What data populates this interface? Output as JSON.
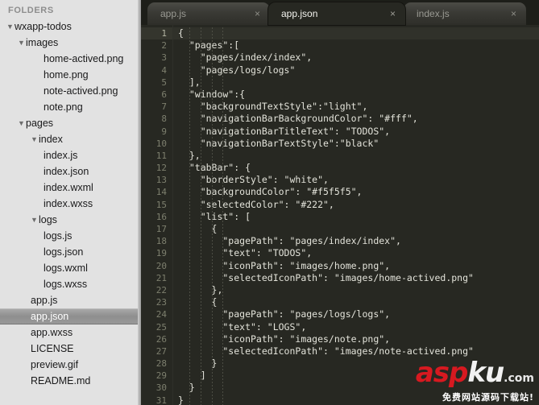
{
  "sidebar": {
    "header": "FOLDERS",
    "tree": [
      {
        "label": "wxapp-todos",
        "depth": 0,
        "type": "folder",
        "expanded": true,
        "selected": false
      },
      {
        "label": "images",
        "depth": 1,
        "type": "folder",
        "expanded": true,
        "selected": false
      },
      {
        "label": "home-actived.png",
        "depth": 3,
        "type": "file",
        "selected": false
      },
      {
        "label": "home.png",
        "depth": 3,
        "type": "file",
        "selected": false
      },
      {
        "label": "note-actived.png",
        "depth": 3,
        "type": "file",
        "selected": false
      },
      {
        "label": "note.png",
        "depth": 3,
        "type": "file",
        "selected": false
      },
      {
        "label": "pages",
        "depth": 1,
        "type": "folder",
        "expanded": true,
        "selected": false
      },
      {
        "label": "index",
        "depth": 2,
        "type": "folder",
        "expanded": true,
        "selected": false
      },
      {
        "label": "index.js",
        "depth": 3,
        "type": "file",
        "selected": false
      },
      {
        "label": "index.json",
        "depth": 3,
        "type": "file",
        "selected": false
      },
      {
        "label": "index.wxml",
        "depth": 3,
        "type": "file",
        "selected": false
      },
      {
        "label": "index.wxss",
        "depth": 3,
        "type": "file",
        "selected": false
      },
      {
        "label": "logs",
        "depth": 2,
        "type": "folder",
        "expanded": true,
        "selected": false
      },
      {
        "label": "logs.js",
        "depth": 3,
        "type": "file",
        "selected": false
      },
      {
        "label": "logs.json",
        "depth": 3,
        "type": "file",
        "selected": false
      },
      {
        "label": "logs.wxml",
        "depth": 3,
        "type": "file",
        "selected": false
      },
      {
        "label": "logs.wxss",
        "depth": 3,
        "type": "file",
        "selected": false
      },
      {
        "label": "app.js",
        "depth": 2,
        "type": "file",
        "selected": false
      },
      {
        "label": "app.json",
        "depth": 2,
        "type": "file",
        "selected": true
      },
      {
        "label": "app.wxss",
        "depth": 2,
        "type": "file",
        "selected": false
      },
      {
        "label": "LICENSE",
        "depth": 2,
        "type": "file",
        "selected": false
      },
      {
        "label": "preview.gif",
        "depth": 2,
        "type": "file",
        "selected": false
      },
      {
        "label": "README.md",
        "depth": 2,
        "type": "file",
        "selected": false
      }
    ],
    "disclosure_glyph": "▼"
  },
  "tabs": {
    "close_glyph": "×",
    "items": [
      {
        "label": "app.js",
        "active": false
      },
      {
        "label": "app.json",
        "active": true
      },
      {
        "label": "index.js",
        "active": false
      }
    ]
  },
  "editor": {
    "filename": "app.json",
    "current_line": 1,
    "first_line_number": 1,
    "lines": [
      "{",
      "  \"pages\":[",
      "    \"pages/index/index\",",
      "    \"pages/logs/logs\"",
      "  ],",
      "  \"window\":{",
      "    \"backgroundTextStyle\":\"light\",",
      "    \"navigationBarBackgroundColor\": \"#fff\",",
      "    \"navigationBarTitleText\": \"TODOS\",",
      "    \"navigationBarTextStyle\":\"black\"",
      "  },",
      "  \"tabBar\": {",
      "    \"borderStyle\": \"white\",",
      "    \"backgroundColor\": \"#f5f5f5\",",
      "    \"selectedColor\": \"#222\",",
      "    \"list\": [",
      "      {",
      "        \"pagePath\": \"pages/index/index\",",
      "        \"text\": \"TODOS\",",
      "        \"iconPath\": \"images/home.png\",",
      "        \"selectedIconPath\": \"images/home-actived.png\"",
      "      },",
      "      {",
      "        \"pagePath\": \"pages/logs/logs\",",
      "        \"text\": \"LOGS\",",
      "        \"iconPath\": \"images/note.png\",",
      "        \"selectedIconPath\": \"images/note-actived.png\"",
      "      }",
      "    ]",
      "  }",
      "}"
    ]
  },
  "watermark": {
    "brand_red": "asp",
    "brand_white": "ku",
    "domain": ".com",
    "tagline": "免费网站源码下载站!"
  },
  "colors": {
    "sidebar_bg": "#e2e2e2",
    "editor_bg": "#272822",
    "tabbar_bg": "#1d1e19",
    "code_text": "#e3e3da",
    "gutter_text": "#7d7f6e",
    "accent_red": "#d71920"
  }
}
